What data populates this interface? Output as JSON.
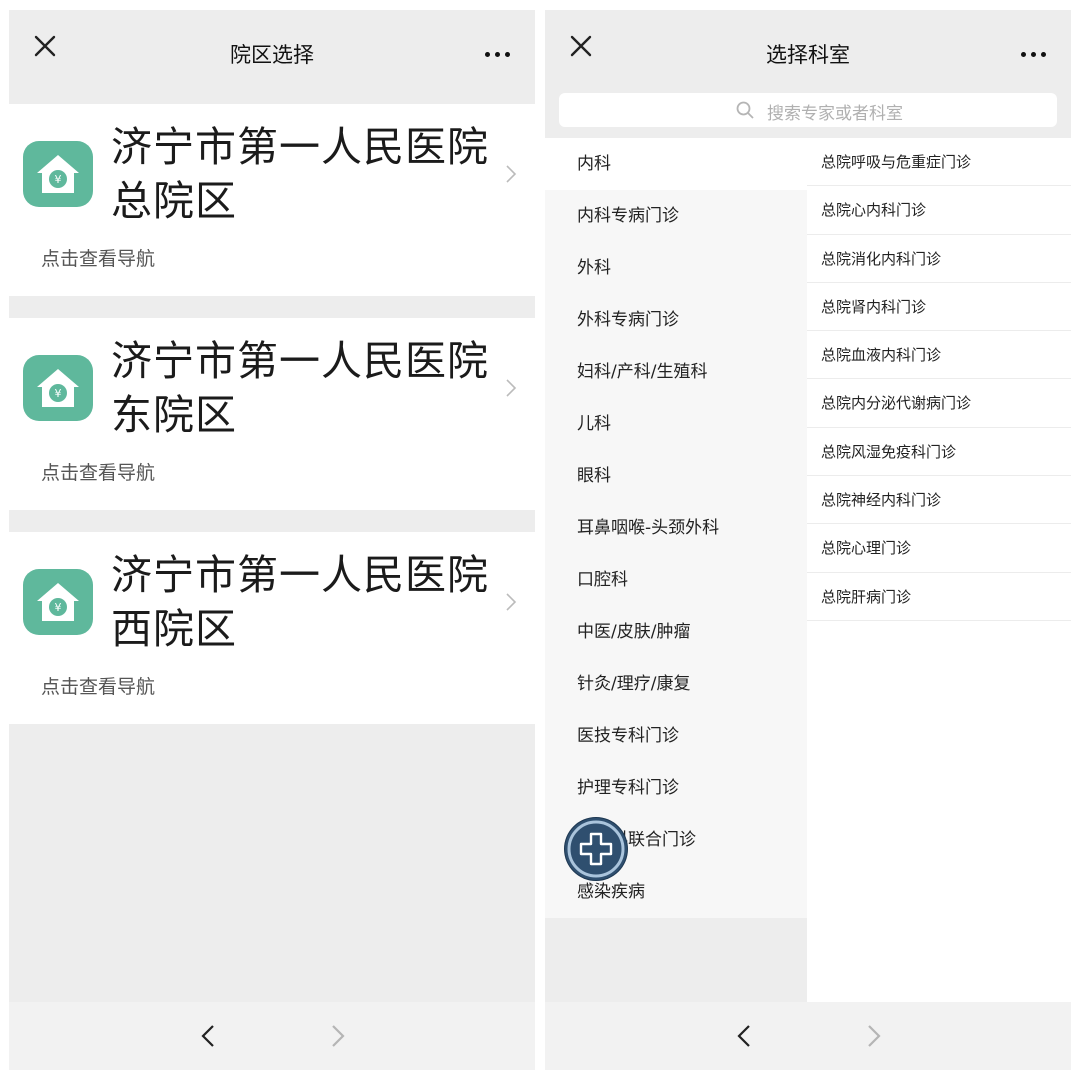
{
  "left": {
    "title": "院区选择",
    "campuses": [
      {
        "name": "济宁市第一人民医院总院区",
        "nav": "点击查看导航"
      },
      {
        "name": "济宁市第一人民医院东院区",
        "nav": "点击查看导航"
      },
      {
        "name": "济宁市第一人民医院西院区",
        "nav": "点击查看导航"
      }
    ]
  },
  "right": {
    "title": "选择科室",
    "search_placeholder": "搜索专家或者科室",
    "departments": [
      "内科",
      "内科专病门诊",
      "外科",
      "外科专病门诊",
      "妇科/产科/生殖科",
      "儿科",
      "眼科",
      "耳鼻咽喉-头颈外科",
      "口腔科",
      "中医/皮肤/肿瘤",
      "针灸/理疗/康复",
      "医技专科门诊",
      "护理专科门诊",
      "多学科联合门诊",
      "感染疾病"
    ],
    "selected_department": "内科",
    "clinics": [
      "总院呼吸与危重症门诊",
      "总院心内科门诊",
      "总院消化内科门诊",
      "总院肾内科门诊",
      "总院血液内科门诊",
      "总院内分泌代谢病门诊",
      "总院风湿免疫科门诊",
      "总院神经内科门诊",
      "总院心理门诊",
      "总院肝病门诊"
    ]
  },
  "icons": {
    "close": "close-icon",
    "more": "more-icon",
    "back": "chevron-left-icon",
    "forward": "chevron-right-icon",
    "search": "search-icon",
    "campus_logo": "hospital-home-icon",
    "fab": "plus-icon"
  },
  "colors": {
    "logo_green": "#5fb89c",
    "panel_bg": "#ededed",
    "fab": "#2f4f6f"
  }
}
